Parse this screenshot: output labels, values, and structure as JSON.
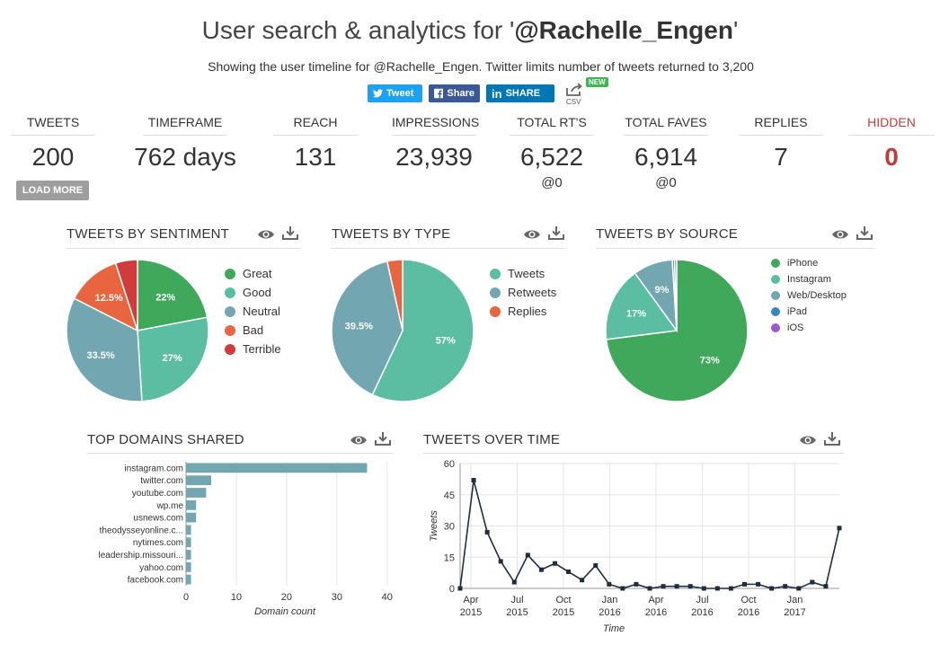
{
  "header": {
    "title_prefix": "User search & analytics for '",
    "title_handle": "@Rachelle_Engen",
    "title_suffix": "'",
    "subtitle": "Showing the user timeline for @Rachelle_Engen. Twitter limits number of tweets returned to 3,200"
  },
  "share": {
    "tweet_label": "Tweet",
    "facebook_label": "Share",
    "linkedin_label": "SHARE",
    "csv_label": "CSV",
    "new_badge": "NEW"
  },
  "stats": [
    {
      "label": "TWEETS",
      "value": "200"
    },
    {
      "label": "TIMEFRAME",
      "value": "762 days"
    },
    {
      "label": "REACH",
      "value": "131"
    },
    {
      "label": "IMPRESSIONS",
      "value": "23,939"
    },
    {
      "label": "TOTAL RT'S",
      "value": "6,522",
      "sub": "@0"
    },
    {
      "label": "TOTAL FAVES",
      "value": "6,914",
      "sub": "@0"
    },
    {
      "label": "REPLIES",
      "value": "7"
    },
    {
      "label": "HIDDEN",
      "value": "0"
    }
  ],
  "load_more_label": "LOAD MORE",
  "colors": {
    "great": "#3fa85a",
    "good": "#5bbda1",
    "neutral": "#72a6b1",
    "bad": "#e8653f",
    "terrible": "#d13b3b",
    "iphone": "#3fa85a",
    "instagram": "#5bbda1",
    "webdesktop": "#72a6b1",
    "ipad": "#3b85c7",
    "ios": "#9b59d6",
    "bar": "#72a6b1",
    "line": "#1f2d3d"
  },
  "icons": {
    "eye": "eye-icon",
    "download": "download-icon"
  },
  "chart_data": [
    {
      "type": "pie",
      "title": "TWEETS BY SENTIMENT",
      "slices": [
        {
          "name": "Great",
          "value": 22,
          "label": "22%"
        },
        {
          "name": "Good",
          "value": 27,
          "label": "27%"
        },
        {
          "name": "Neutral",
          "value": 33.5,
          "label": "33.5%"
        },
        {
          "name": "Bad",
          "value": 12.5,
          "label": "12.5%"
        },
        {
          "name": "Terrible",
          "value": 5,
          "label": ""
        }
      ]
    },
    {
      "type": "pie",
      "title": "TWEETS BY TYPE",
      "slices": [
        {
          "name": "Tweets",
          "value": 57,
          "label": "57%"
        },
        {
          "name": "Retweets",
          "value": 39.5,
          "label": "39.5%"
        },
        {
          "name": "Replies",
          "value": 3.5,
          "label": ""
        }
      ]
    },
    {
      "type": "pie",
      "title": "TWEETS BY SOURCE",
      "slices": [
        {
          "name": "iPhone",
          "value": 73,
          "label": "73%"
        },
        {
          "name": "Instagram",
          "value": 17,
          "label": "17%"
        },
        {
          "name": "Web/Desktop",
          "value": 9,
          "label": "9%"
        },
        {
          "name": "iPad",
          "value": 0.5,
          "label": ""
        },
        {
          "name": "iOS",
          "value": 0.5,
          "label": ""
        }
      ]
    },
    {
      "type": "bar",
      "title": "TOP DOMAINS SHARED",
      "orientation": "horizontal",
      "categories": [
        "instagram.com",
        "twitter.com",
        "youtube.com",
        "wp.me",
        "usnews.com",
        "theodysseyonline.c...",
        "nytimes.com",
        "leadership.missouri...",
        "yahoo.com",
        "facebook.com"
      ],
      "values": [
        36,
        5,
        4,
        2,
        2,
        1,
        1,
        1,
        1,
        1
      ],
      "xlabel": "Domain count",
      "xlim": [
        0,
        42
      ],
      "xticks": [
        0,
        10,
        20,
        30,
        40
      ]
    },
    {
      "type": "line",
      "title": "TWEETS OVER TIME",
      "ylabel": "Tweets",
      "xlabel": "Time",
      "ylim": [
        0,
        60
      ],
      "yticks": [
        0,
        15,
        30,
        45,
        60
      ],
      "xtick_labels": [
        [
          "Apr",
          "2015"
        ],
        [
          "Jul",
          "2015"
        ],
        [
          "Oct",
          "2015"
        ],
        [
          "Jan",
          "2016"
        ],
        [
          "Apr",
          "2016"
        ],
        [
          "Jul",
          "2016"
        ],
        [
          "Oct",
          "2016"
        ],
        [
          "Jan",
          "2017"
        ]
      ],
      "x": [
        "2015-03",
        "2015-04",
        "2015-05",
        "2015-06",
        "2015-07",
        "2015-08",
        "2015-09",
        "2015-10",
        "2015-11",
        "2015-12",
        "2016-01",
        "2016-02",
        "2016-03",
        "2016-04",
        "2016-05",
        "2016-06",
        "2016-07",
        "2016-08",
        "2016-09",
        "2016-10",
        "2016-11",
        "2016-12",
        "2017-01",
        "2017-02",
        "2017-03",
        "2017-04"
      ],
      "values": [
        0,
        52,
        27,
        13,
        3,
        16,
        9,
        12,
        8,
        4,
        11,
        2,
        0,
        2,
        0,
        1,
        1,
        1,
        0,
        0,
        0,
        2,
        2,
        0,
        1,
        0,
        3,
        1,
        29
      ]
    }
  ]
}
